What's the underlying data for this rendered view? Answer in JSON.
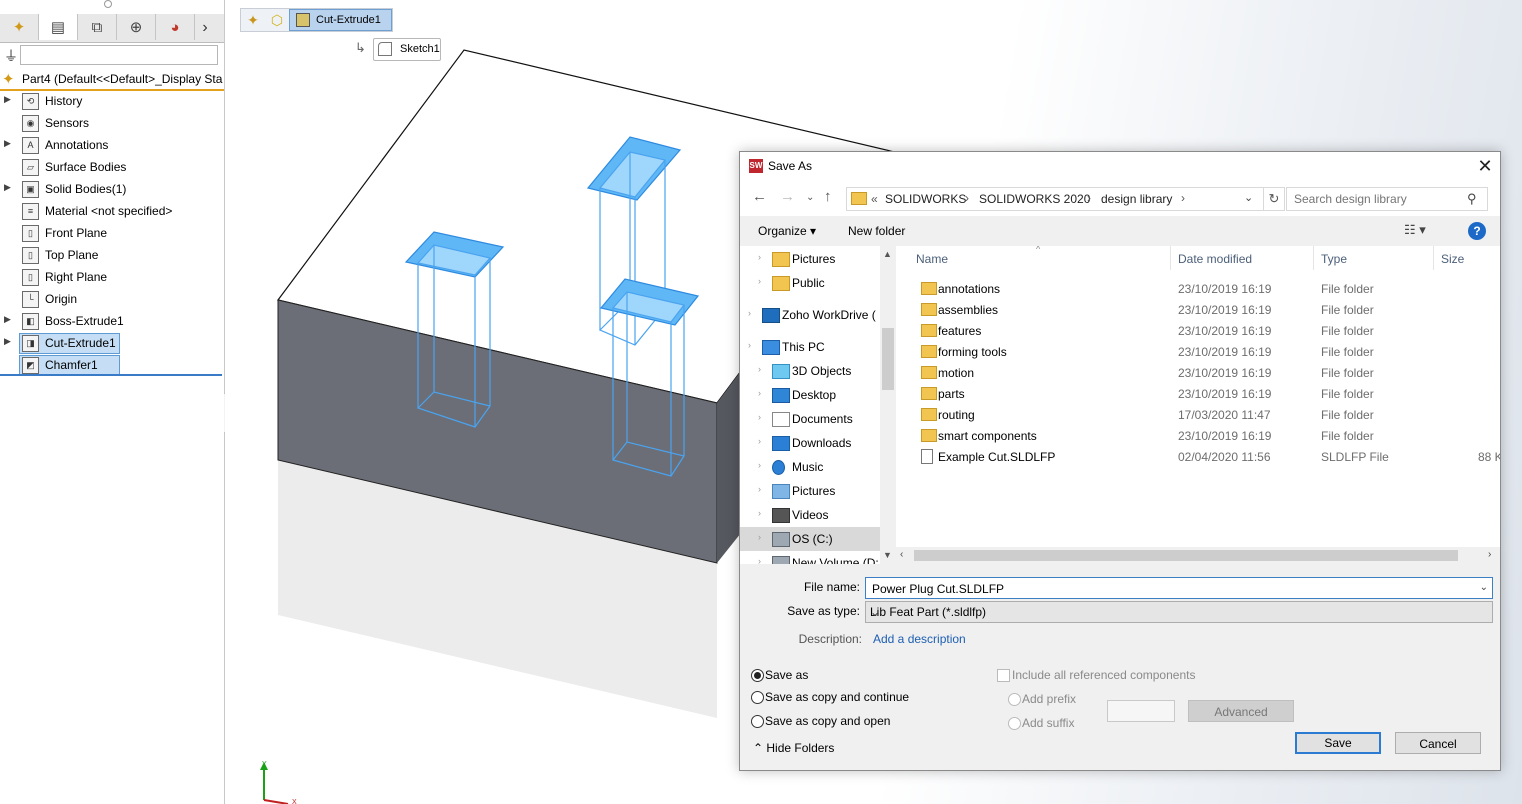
{
  "feature_manager": {
    "part_label": "Part4  (Default<<Default>_Display Sta",
    "tree_items": [
      {
        "label": "History",
        "icon": "history-icon",
        "glyph": "⟲",
        "expandable": true
      },
      {
        "label": "Sensors",
        "icon": "sensor-icon",
        "glyph": "◉",
        "expandable": false
      },
      {
        "label": "Annotations",
        "icon": "annotation-icon",
        "glyph": "A",
        "expandable": true
      },
      {
        "label": "Surface Bodies",
        "icon": "surface-bodies-icon",
        "glyph": "▱",
        "expandable": false
      },
      {
        "label": "Solid Bodies(1)",
        "icon": "solid-bodies-icon",
        "glyph": "▣",
        "expandable": true
      },
      {
        "label": "Material <not specified>",
        "icon": "material-icon",
        "glyph": "≡",
        "expandable": false
      },
      {
        "label": "Front Plane",
        "icon": "plane-icon",
        "glyph": "▯",
        "expandable": false
      },
      {
        "label": "Top Plane",
        "icon": "plane-icon",
        "glyph": "▯",
        "expandable": false
      },
      {
        "label": "Right Plane",
        "icon": "plane-icon",
        "glyph": "▯",
        "expandable": false
      },
      {
        "label": "Origin",
        "icon": "origin-icon",
        "glyph": "└",
        "expandable": false
      },
      {
        "label": "Boss-Extrude1",
        "icon": "boss-extrude-icon",
        "glyph": "◧",
        "expandable": true
      },
      {
        "label": "Cut-Extrude1",
        "icon": "cut-extrude-icon",
        "glyph": "◨",
        "expandable": true,
        "selected": true
      },
      {
        "label": "Chamfer1",
        "icon": "chamfer-icon",
        "glyph": "◩",
        "expandable": false,
        "selected": true
      }
    ]
  },
  "graphics": {
    "breadcrumb_active": "Cut-Extrude1",
    "sketch_tag": "Sketch1",
    "triad": {
      "y": "Y",
      "x": "X"
    }
  },
  "dialog": {
    "title": "Save As",
    "address": {
      "prefix": "«",
      "crumbs": [
        "SOLIDWORKS",
        "SOLIDWORKS 2020",
        "design library"
      ]
    },
    "search_placeholder": "Search design library",
    "organize_label": "Organize ▾",
    "new_folder_label": "New folder",
    "help_glyph": "?",
    "nav_items": [
      {
        "label": "Pictures",
        "icon": "folder",
        "indent": 1
      },
      {
        "label": "Public",
        "icon": "folder",
        "indent": 1
      },
      {
        "label": "Zoho WorkDrive (",
        "icon": "zoho",
        "indent": 0
      },
      {
        "label": "This PC",
        "icon": "pc",
        "indent": 0
      },
      {
        "label": "3D Objects",
        "icon": "3d",
        "indent": 1
      },
      {
        "label": "Desktop",
        "icon": "desk",
        "indent": 1
      },
      {
        "label": "Documents",
        "icon": "doc",
        "indent": 1
      },
      {
        "label": "Downloads",
        "icon": "down",
        "indent": 1
      },
      {
        "label": "Music",
        "icon": "music",
        "indent": 1
      },
      {
        "label": "Pictures",
        "icon": "pics",
        "indent": 1
      },
      {
        "label": "Videos",
        "icon": "vid",
        "indent": 1
      },
      {
        "label": "OS (C:)",
        "icon": "os",
        "indent": 1,
        "selected": true
      },
      {
        "label": "New Volume (D:",
        "icon": "os",
        "indent": 1
      }
    ],
    "columns": {
      "name": "Name",
      "date": "Date modified",
      "type": "Type",
      "size": "Size"
    },
    "files": [
      {
        "name": "annotations",
        "date": "23/10/2019 16:19",
        "type": "File folder",
        "size": "",
        "kind": "folder"
      },
      {
        "name": "assemblies",
        "date": "23/10/2019 16:19",
        "type": "File folder",
        "size": "",
        "kind": "folder"
      },
      {
        "name": "features",
        "date": "23/10/2019 16:19",
        "type": "File folder",
        "size": "",
        "kind": "folder"
      },
      {
        "name": "forming tools",
        "date": "23/10/2019 16:19",
        "type": "File folder",
        "size": "",
        "kind": "folder"
      },
      {
        "name": "motion",
        "date": "23/10/2019 16:19",
        "type": "File folder",
        "size": "",
        "kind": "folder"
      },
      {
        "name": "parts",
        "date": "23/10/2019 16:19",
        "type": "File folder",
        "size": "",
        "kind": "folder"
      },
      {
        "name": "routing",
        "date": "17/03/2020 11:47",
        "type": "File folder",
        "size": "",
        "kind": "folder"
      },
      {
        "name": "smart components",
        "date": "23/10/2019 16:19",
        "type": "File folder",
        "size": "",
        "kind": "folder"
      },
      {
        "name": "Example Cut.SLDLFP",
        "date": "02/04/2020 11:56",
        "type": "SLDLFP File",
        "size": "88 K",
        "kind": "file"
      }
    ],
    "file_name_label": "File name:",
    "file_name_value": "Power Plug Cut.SLDLFP",
    "save_type_label": "Save as type:",
    "save_type_value": "Lib Feat Part (*.sldlfp)",
    "description_label": "Description:",
    "description_link": "Add a description",
    "options": {
      "save_as": "Save as",
      "save_copy_continue": "Save as copy and continue",
      "save_copy_open": "Save as copy and open",
      "include_refs": "Include all referenced components",
      "add_prefix": "Add prefix",
      "add_suffix": "Add suffix"
    },
    "advanced_label": "Advanced",
    "hide_folders_label": "Hide Folders",
    "save_label": "Save",
    "cancel_label": "Cancel"
  }
}
